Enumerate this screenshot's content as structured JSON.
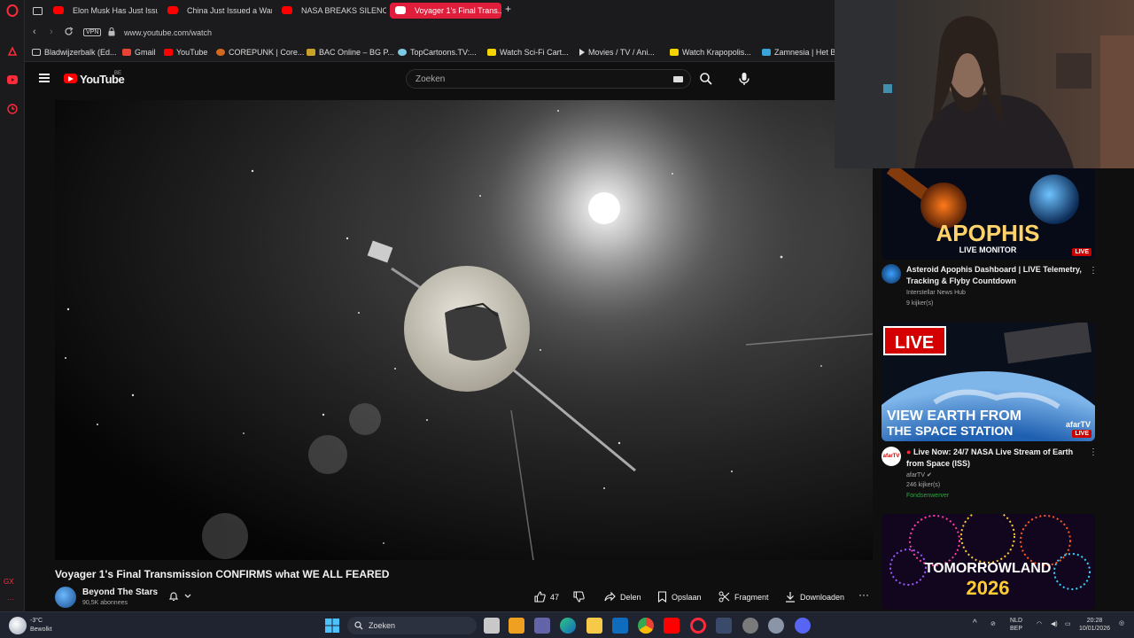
{
  "browser": {
    "tabs": [
      {
        "label": "Elon Musk Has Just Issue..."
      },
      {
        "label": "China Just Issued a Warni..."
      },
      {
        "label": "NASA BREAKS SILENCE o..."
      },
      {
        "label": "Voyager 1's Final Trans..."
      }
    ],
    "vpn_label": "VPN",
    "url": "www.youtube.com/watch",
    "bookmarks": [
      {
        "label": "Bladwijzerbalk (Ed..."
      },
      {
        "label": "Gmail"
      },
      {
        "label": "YouTube"
      },
      {
        "label": "COREPUNK | Core..."
      },
      {
        "label": "BAC Online – BG P..."
      },
      {
        "label": "TopCartoons.TV:..."
      },
      {
        "label": "Watch Sci-Fi Cart..."
      },
      {
        "label": "Movies / TV / Ani..."
      },
      {
        "label": "Watch Krapopolis..."
      },
      {
        "label": "Zamnesia | Het Be..."
      }
    ],
    "side_rail_badge": "GX"
  },
  "youtube": {
    "logo_text": "YouTube",
    "country_code": "BE",
    "search_placeholder": "Zoeken"
  },
  "video": {
    "title": "Voyager 1's Final Transmission CONFIRMS what WE ALL FEARED",
    "channel": "Beyond The Stars",
    "subscribers": "90,5K abonnees",
    "likes": "47",
    "actions": {
      "share": "Delen",
      "save": "Opslaan",
      "clip": "Fragment",
      "download": "Downloaden"
    }
  },
  "recommendations": [
    {
      "thumb_line1": "APOPHIS",
      "thumb_line2": "LIVE MONITOR",
      "live_tag": "LIVE",
      "title": "Asteroid Apophis Dashboard | LIVE Telemetry, Tracking & Flyby Countdown",
      "channel": "Interstellar News Hub",
      "viewers": "9 kijker(s)"
    },
    {
      "thumb_badge": "LIVE",
      "thumb_line1": "VIEW EARTH FROM",
      "thumb_line2": "THE SPACE STATION",
      "thumb_brand": "afarTV",
      "live_tag": "LIVE",
      "avatar_text": "afarTV",
      "title": "Live Now: 24/7 NASA Live Stream of Earth from Space (ISS)",
      "channel": "afarTV",
      "viewers": "246 kijker(s)",
      "badge": "Fondsenwerver"
    },
    {
      "thumb_line1": "TOMORROWLAND",
      "thumb_line2": "2026"
    }
  ],
  "taskbar": {
    "weather_temp": "-3°C",
    "weather_desc": "Bewolkt",
    "search_label": "Zoeken",
    "lang": "NLD",
    "lang_sub": "BEP",
    "time": "20:28",
    "date": "10/01/2026"
  }
}
